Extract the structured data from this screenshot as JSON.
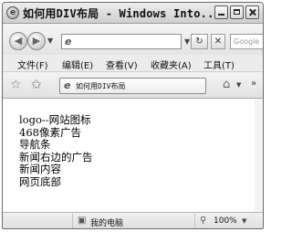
{
  "window": {
    "title": "如何用DIV布局 - Windows Into..."
  },
  "address_bar": {
    "url": "",
    "search_placeholder": "Google"
  },
  "menu": {
    "items": [
      "文件(F)",
      "编辑(E)",
      "查看(V)",
      "收藏夹(A)",
      "工具(T)"
    ]
  },
  "tab": {
    "label": "如何用DIV布局"
  },
  "content": {
    "lines": [
      "logo--网站图标",
      "468像素广告",
      "导航条",
      "新闻右边的广告",
      "新闻内容",
      "网页底部"
    ]
  },
  "status": {
    "zone": "我的电脑",
    "zoom": "100%"
  },
  "icons": {
    "back": "back-arrow-icon",
    "forward": "forward-arrow-icon",
    "refresh": "refresh-icon",
    "stop": "stop-icon",
    "favorites": "star-icon",
    "add_favorites": "add-favorite-icon",
    "home": "home-icon",
    "computer": "computer-icon",
    "zoom": "magnifier-icon"
  }
}
